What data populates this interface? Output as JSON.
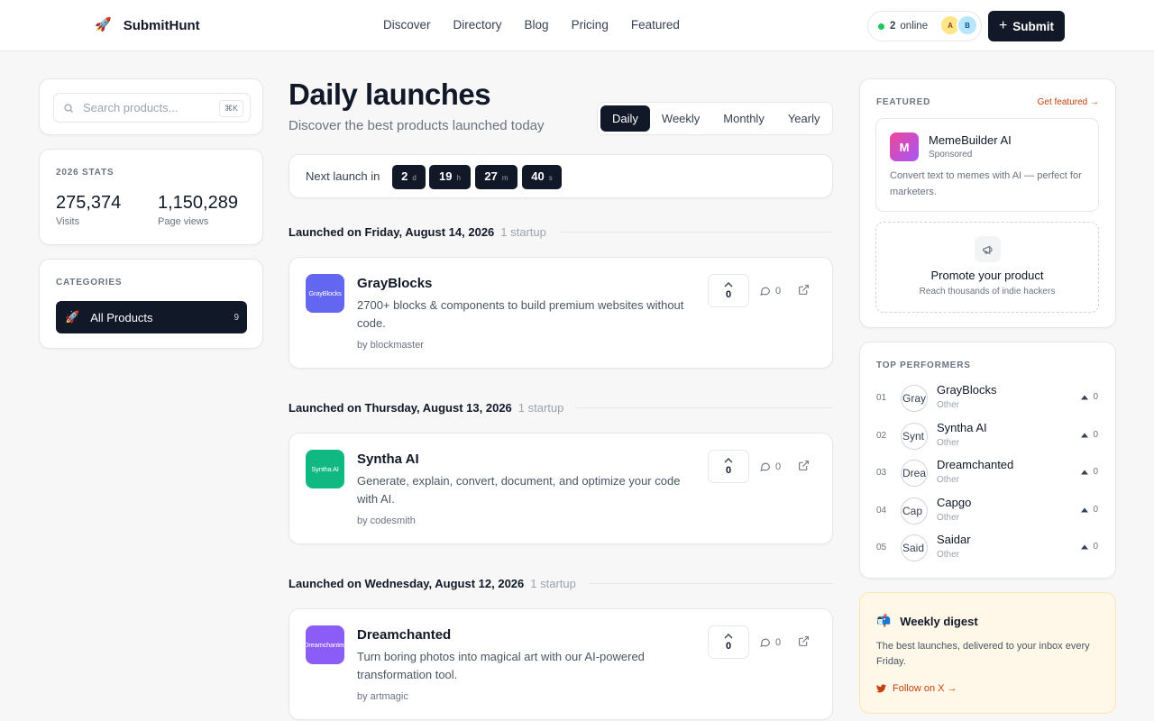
{
  "brand": {
    "name": "SubmitHunt"
  },
  "nav": {
    "links": [
      "Discover",
      "Directory",
      "Blog",
      "Pricing",
      "Featured"
    ]
  },
  "online": {
    "count": "2",
    "label": "online",
    "avatars": [
      "A",
      "B"
    ]
  },
  "submit": {
    "label": "Submit"
  },
  "search": {
    "placeholder": "Search products...",
    "shortcut": "⌘K"
  },
  "stats": {
    "title": "2026 STATS",
    "visits": "275,374",
    "visits_label": "Visits",
    "pageviews": "1,150,289",
    "pageviews_label": "Page views"
  },
  "categories": {
    "title": "CATEGORIES",
    "items": [
      {
        "label": "All Products",
        "count": "9"
      }
    ]
  },
  "main": {
    "title": "Daily launches",
    "subtitle": "Discover the best products launched today"
  },
  "periods": {
    "tabs": [
      "Daily",
      "Weekly",
      "Monthly",
      "Yearly"
    ],
    "active": "Daily"
  },
  "countdown": {
    "label": "Next launch in",
    "units": [
      {
        "v": "2",
        "u": "d"
      },
      {
        "v": "19",
        "u": "h"
      },
      {
        "v": "27",
        "u": "m"
      },
      {
        "v": "40",
        "u": "s"
      }
    ]
  },
  "days": [
    {
      "heading": "Launched on Friday, August 14, 2026",
      "count": "1 startup",
      "product": {
        "name": "GrayBlocks",
        "logo_text": "GrayBlocks",
        "logo_color": "#6366f1",
        "desc": "2700+ blocks & components to build premium websites without code.",
        "by": "by blockmaster",
        "votes": "0",
        "comments": "0"
      }
    },
    {
      "heading": "Launched on Thursday, August 13, 2026",
      "count": "1 startup",
      "product": {
        "name": "Syntha AI",
        "logo_text": "Syntha AI",
        "logo_color": "#10b981",
        "desc": "Generate, explain, convert, document, and optimize your code with AI.",
        "by": "by codesmith",
        "votes": "0",
        "comments": "0"
      }
    },
    {
      "heading": "Launched on Wednesday, August 12, 2026",
      "count": "1 startup",
      "product": {
        "name": "Dreamchanted",
        "logo_text": "Dreamchanted",
        "logo_color": "#8b5cf6",
        "desc": "Turn boring photos into magical art with our AI-powered transformation tool.",
        "by": "by artmagic",
        "votes": "0",
        "comments": "0"
      }
    }
  ],
  "featured": {
    "title": "FEATURED",
    "link": "Get featured →",
    "item": {
      "initial": "M",
      "name": "MemeBuilder AI",
      "tag": "Sponsored",
      "desc": "Convert text to memes with AI — perfect for marketers."
    },
    "promo": {
      "title": "Promote your product",
      "sub": "Reach thousands of indie hackers"
    }
  },
  "top": {
    "title": "TOP PERFORMERS",
    "items": [
      {
        "rank": "01",
        "name": "GrayBlocks",
        "cat": "Other",
        "votes": "0",
        "av": "Gray"
      },
      {
        "rank": "02",
        "name": "Syntha AI",
        "cat": "Other",
        "votes": "0",
        "av": "Synt"
      },
      {
        "rank": "03",
        "name": "Dreamchanted",
        "cat": "Other",
        "votes": "0",
        "av": "Drea"
      },
      {
        "rank": "04",
        "name": "Capgo",
        "cat": "Other",
        "votes": "0",
        "av": "Cap"
      },
      {
        "rank": "05",
        "name": "Saidar",
        "cat": "Other",
        "votes": "0",
        "av": "Said"
      }
    ]
  },
  "digest": {
    "title": "Weekly digest",
    "desc": "The best launches, delivered to your inbox every Friday.",
    "link": "Follow on X →"
  }
}
